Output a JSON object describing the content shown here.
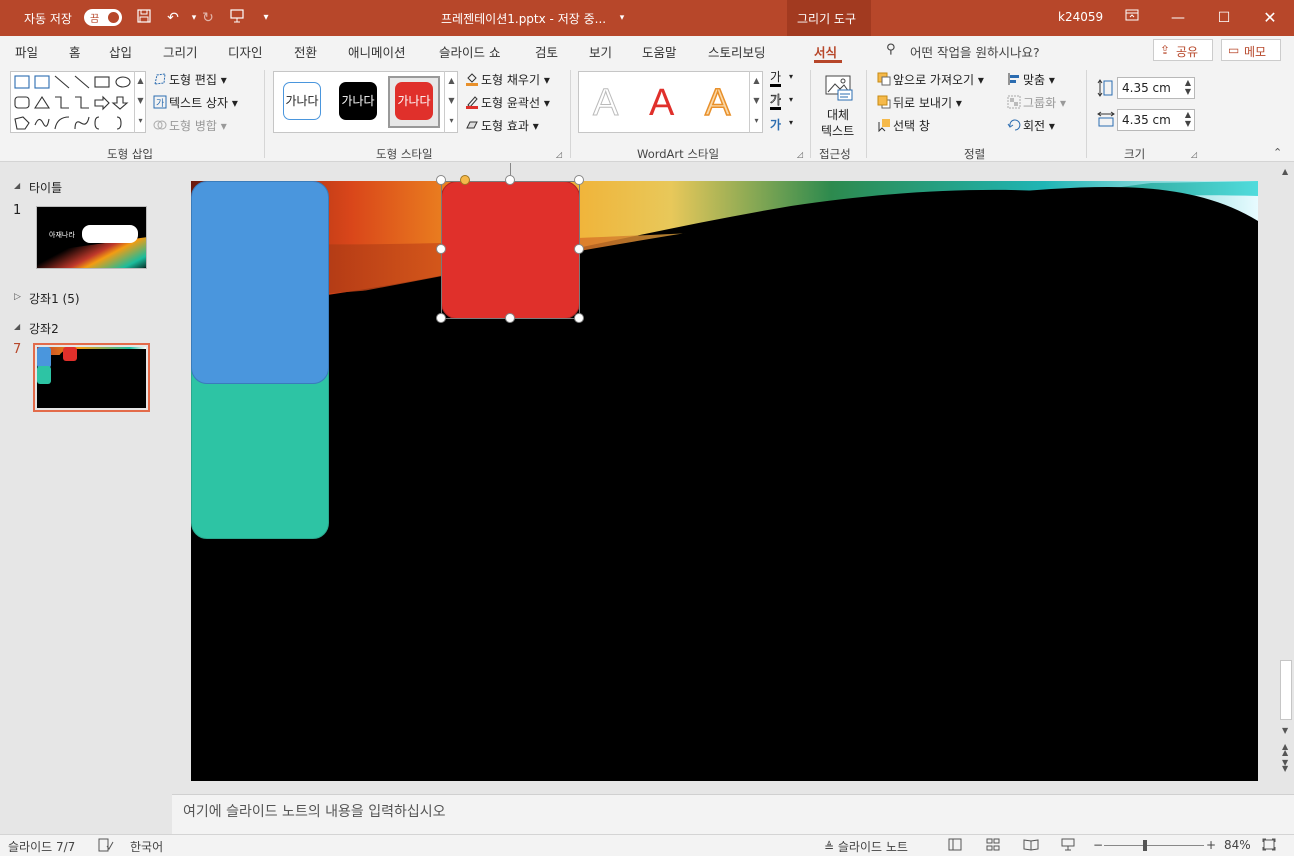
{
  "titlebar": {
    "autosave_label": "자동 저장",
    "autosave_toggle": "끔",
    "doc_title": "프레젠테이션1.pptx  -  저장 중...",
    "context_tool": "그리기 도구",
    "user": "k24059"
  },
  "tabs": [
    "파일",
    "홈",
    "삽입",
    "그리기",
    "디자인",
    "전환",
    "애니메이션",
    "슬라이드 쇼",
    "검토",
    "보기",
    "도움말",
    "스토리보딩",
    "서식"
  ],
  "search": {
    "placeholder": "어떤 작업을 원하시나요?"
  },
  "share_label": "공유",
  "memo_label": "메모",
  "ribbon": {
    "insert_shapes": {
      "edit_shape": "도형 편집",
      "text_box": "텍스트 상자",
      "merge_shapes": "도형 병합",
      "label": "도형 삽입"
    },
    "shape_styles": {
      "preset_text": "가나다",
      "fill": "도형 채우기",
      "outline": "도형 윤곽선",
      "effects": "도형 효과",
      "label": "도형 스타일"
    },
    "wordart": {
      "sample": "A",
      "label": "WordArt 스타일",
      "text_sample": "가"
    },
    "accessibility": {
      "alt_text_line1": "대체",
      "alt_text_line2": "텍스트",
      "label": "접근성"
    },
    "arrange": {
      "bring_forward": "앞으로 가져오기",
      "send_backward": "뒤로 보내기",
      "selection_pane": "선택 창",
      "align": "맞춤",
      "group": "그룹화",
      "rotate": "회전",
      "label": "정렬"
    },
    "size": {
      "height": "4.35 cm",
      "width": "4.35 cm",
      "label": "크기"
    }
  },
  "thumbnails": {
    "section1": "타이틀",
    "slide1_number": "1",
    "slide1_title_text": "아재나라",
    "section2": "강좌1 (5)",
    "section3": "강좌2",
    "slide7_number": "7"
  },
  "notes_placeholder": "여기에 슬라이드 노트의 내용을 입력하십시오",
  "status": {
    "slide_counter": "슬라이드 7/7",
    "language": "한국어",
    "notes_button": "슬라이드 노트",
    "zoom": "84%"
  },
  "colors": {
    "accent": "#b7472a",
    "blue_shape": "#4a96dd",
    "green_shape": "#2dc4a4",
    "red_shape": "#e0302b"
  }
}
